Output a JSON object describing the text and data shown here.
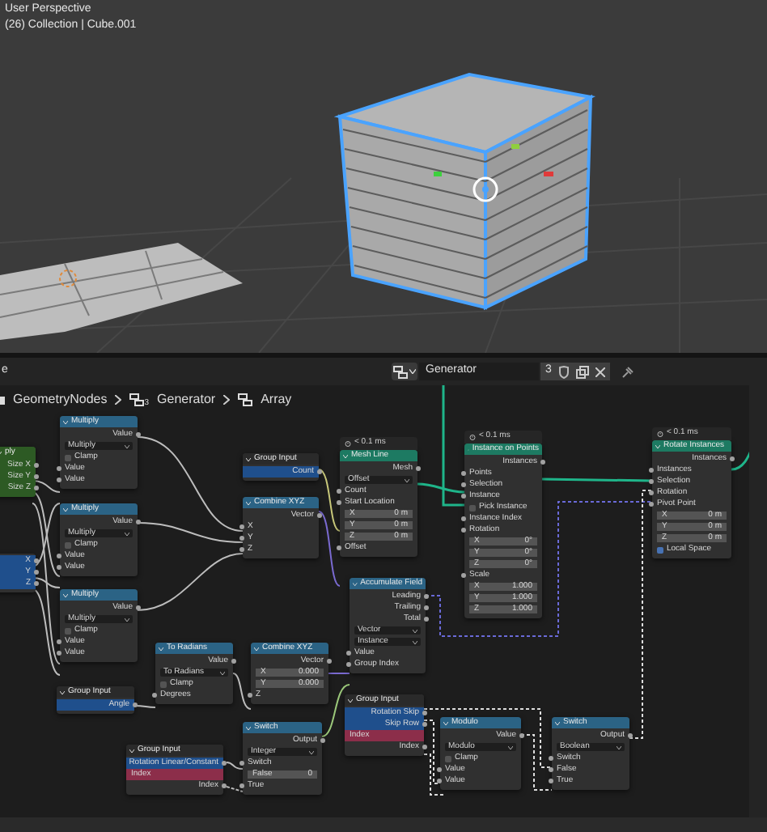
{
  "viewport": {
    "title": "User Perspective",
    "subtitle": "(26) Collection | Cube.001"
  },
  "header": {
    "left_text": "e",
    "tree_name": "Generator",
    "user_count": "3"
  },
  "breadcrumbs": [
    {
      "label": "GeometryNodes"
    },
    {
      "label": "Generator",
      "subscript": "3"
    },
    {
      "label": "Array"
    }
  ],
  "nodes": [
    {
      "title": "ply",
      "kind": "group",
      "color": "#2d5a24",
      "rows": [
        {
          "kind": "output",
          "label": "Size X"
        },
        {
          "kind": "output",
          "label": "Size Y"
        },
        {
          "kind": "output",
          "label": "Size Z"
        }
      ]
    },
    {
      "kind": "plain",
      "rows": [
        {
          "kind": "group_output",
          "label": "X"
        },
        {
          "kind": "group_output",
          "label": "Y"
        },
        {
          "kind": "group_output",
          "label": "Z"
        }
      ]
    },
    {
      "title": "Multiply",
      "kind": "plain",
      "color": "#2b6385",
      "rows": [
        {
          "kind": "output",
          "label": "Value"
        },
        {
          "kind": "dropdown",
          "label": "Multiply"
        },
        {
          "kind": "checkbox",
          "label": "Clamp",
          "checked": false
        },
        {
          "kind": "input",
          "label": "Value"
        },
        {
          "kind": "input",
          "label": "Value"
        }
      ]
    },
    {
      "title": "Multiply",
      "kind": "plain",
      "color": "#2b6385",
      "rows": [
        {
          "kind": "output",
          "label": "Value"
        },
        {
          "kind": "dropdown",
          "label": "Multiply"
        },
        {
          "kind": "checkbox",
          "label": "Clamp",
          "checked": false
        },
        {
          "kind": "input",
          "label": "Value"
        },
        {
          "kind": "input",
          "label": "Value"
        }
      ]
    },
    {
      "title": "Multiply",
      "kind": "plain",
      "color": "#2b6385",
      "rows": [
        {
          "kind": "output",
          "label": "Value"
        },
        {
          "kind": "dropdown",
          "label": "Multiply"
        },
        {
          "kind": "checkbox",
          "label": "Clamp",
          "checked": false
        },
        {
          "kind": "input",
          "label": "Value"
        },
        {
          "kind": "input",
          "label": "Value"
        }
      ]
    },
    {
      "title": "Group Input",
      "kind": "plain",
      "color": "#2a2a2a",
      "rows": [
        {
          "kind": "group_output",
          "label": "Angle"
        }
      ]
    },
    {
      "title": "To Radians",
      "kind": "plain",
      "color": "#2b6385",
      "rows": [
        {
          "kind": "output",
          "label": "Value"
        },
        {
          "kind": "dropdown",
          "label": "To Radians"
        },
        {
          "kind": "checkbox",
          "label": "Clamp",
          "checked": false
        },
        {
          "kind": "input",
          "label": "Degrees"
        }
      ]
    },
    {
      "title": "Group Input",
      "kind": "plain",
      "color": "#2a2a2a",
      "rows": [
        {
          "kind": "group_output",
          "label": "Rotation Linear/Constant"
        },
        {
          "kind": "attribute_bar",
          "label": "Index"
        },
        {
          "kind": "output",
          "label": "Index"
        }
      ]
    },
    {
      "title": "Group Input",
      "kind": "plain",
      "color": "#2a2a2a",
      "rows": [
        {
          "kind": "group_output",
          "label": "Count"
        }
      ]
    },
    {
      "title": "Combine XYZ",
      "kind": "plain",
      "color": "#2b6385",
      "rows": [
        {
          "kind": "output",
          "label": "Vector"
        },
        {
          "kind": "input",
          "label": "X"
        },
        {
          "kind": "input",
          "label": "Y"
        },
        {
          "kind": "input",
          "label": "Z"
        }
      ]
    },
    {
      "title": "Mesh Line",
      "kind": "plain",
      "color": "#1d7a62",
      "timing": "< 0.1 ms",
      "rows": [
        {
          "kind": "output",
          "label": "Mesh"
        },
        {
          "kind": "dropdown",
          "label": "Offset"
        },
        {
          "kind": "input",
          "label": "Count"
        },
        {
          "kind": "input",
          "label": "Start Location"
        },
        {
          "kind": "vector",
          "label": "X",
          "value": "0 m"
        },
        {
          "kind": "vector",
          "label": "Y",
          "value": "0 m"
        },
        {
          "kind": "vector",
          "label": "Z",
          "value": "0 m"
        },
        {
          "kind": "input",
          "label": "Offset"
        }
      ]
    },
    {
      "title": "Accumulate Field",
      "kind": "plain",
      "color": "#2b6385",
      "rows": [
        {
          "kind": "output",
          "label": "Leading"
        },
        {
          "kind": "output",
          "label": "Trailing"
        },
        {
          "kind": "output",
          "label": "Total"
        },
        {
          "kind": "dropdown",
          "label": "Vector"
        },
        {
          "kind": "dropdown",
          "label": "Instance"
        },
        {
          "kind": "input",
          "label": "Value"
        },
        {
          "kind": "input",
          "label": "Group Index"
        }
      ]
    },
    {
      "title": "Combine XYZ",
      "kind": "plain",
      "color": "#2b6385",
      "rows": [
        {
          "kind": "output",
          "label": "Vector"
        },
        {
          "kind": "vector",
          "label": "X",
          "value": "0.000"
        },
        {
          "kind": "vector",
          "label": "Y",
          "value": "0.000"
        },
        {
          "kind": "input",
          "label": "Z"
        }
      ]
    },
    {
      "title": "Switch",
      "kind": "plain",
      "color": "#2b6385",
      "rows": [
        {
          "kind": "output",
          "label": "Output"
        },
        {
          "kind": "dropdown",
          "label": "Integer"
        },
        {
          "kind": "input",
          "label": "Switch"
        },
        {
          "kind": "vector",
          "label": "False",
          "value": "0"
        },
        {
          "kind": "input",
          "label": "True"
        }
      ]
    },
    {
      "title": "Group Input",
      "kind": "plain",
      "color": "#2a2a2a",
      "rows": [
        {
          "kind": "group_output",
          "label": "Rotation Skip"
        },
        {
          "kind": "group_output",
          "label": "Skip Row"
        },
        {
          "kind": "attribute_bar",
          "label": "Index"
        },
        {
          "kind": "output",
          "label": "Index"
        }
      ]
    },
    {
      "title": "Instance on Points",
      "kind": "plain",
      "color": "#1d7a62",
      "timing": "< 0.1 ms",
      "rows": [
        {
          "kind": "output",
          "label": "Instances"
        },
        {
          "kind": "input",
          "label": "Points"
        },
        {
          "kind": "input",
          "label": "Selection"
        },
        {
          "kind": "input",
          "label": "Instance"
        },
        {
          "kind": "checkbox",
          "label": "Pick Instance",
          "checked": false
        },
        {
          "kind": "input",
          "label": "Instance Index"
        },
        {
          "kind": "input",
          "label": "Rotation"
        },
        {
          "kind": "vector",
          "label": "X",
          "value": "0°"
        },
        {
          "kind": "vector",
          "label": "Y",
          "value": "0°"
        },
        {
          "kind": "vector",
          "label": "Z",
          "value": "0°"
        },
        {
          "kind": "input",
          "label": "Scale"
        },
        {
          "kind": "vector",
          "label": "X",
          "value": "1.000"
        },
        {
          "kind": "vector",
          "label": "Y",
          "value": "1.000"
        },
        {
          "kind": "vector",
          "label": "Z",
          "value": "1.000"
        }
      ]
    },
    {
      "title": "Rotate Instances",
      "kind": "plain",
      "color": "#1d7a62",
      "timing": "< 0.1 ms",
      "rows": [
        {
          "kind": "output",
          "label": "Instances"
        },
        {
          "kind": "input",
          "label": "Instances"
        },
        {
          "kind": "input",
          "label": "Selection"
        },
        {
          "kind": "input",
          "label": "Rotation"
        },
        {
          "kind": "input",
          "label": "Pivot Point"
        },
        {
          "kind": "vector",
          "label": "X",
          "value": "0 m"
        },
        {
          "kind": "vector",
          "label": "Y",
          "value": "0 m"
        },
        {
          "kind": "vector",
          "label": "Z",
          "value": "0 m"
        },
        {
          "kind": "checkbox",
          "label": "Local Space",
          "checked": true
        }
      ]
    },
    {
      "title": "Modulo",
      "kind": "plain",
      "color": "#2b6385",
      "rows": [
        {
          "kind": "output",
          "label": "Value"
        },
        {
          "kind": "dropdown",
          "label": "Modulo"
        },
        {
          "kind": "checkbox",
          "label": "Clamp",
          "checked": false
        },
        {
          "kind": "input",
          "label": "Value"
        },
        {
          "kind": "input",
          "label": "Value"
        }
      ]
    },
    {
      "title": "Switch",
      "kind": "plain",
      "color": "#2b6385",
      "rows": [
        {
          "kind": "output",
          "label": "Output"
        },
        {
          "kind": "dropdown",
          "label": "Boolean"
        },
        {
          "kind": "input",
          "label": "Switch"
        },
        {
          "kind": "input",
          "label": "False"
        },
        {
          "kind": "input",
          "label": "True"
        }
      ]
    }
  ]
}
